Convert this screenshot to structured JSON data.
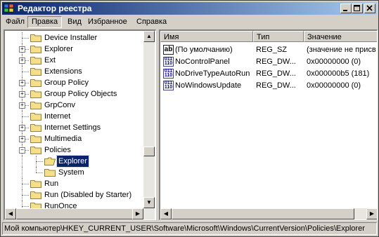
{
  "window": {
    "title": "Редактор реестра"
  },
  "menu": [
    "Файл",
    "Правка",
    "Вид",
    "Избранное",
    "Справка"
  ],
  "tree": [
    {
      "label": "Device Installer",
      "expander": ""
    },
    {
      "label": "Explorer",
      "expander": "+"
    },
    {
      "label": "Ext",
      "expander": "+"
    },
    {
      "label": "Extensions",
      "expander": ""
    },
    {
      "label": "Group Policy",
      "expander": "+"
    },
    {
      "label": "Group Policy Objects",
      "expander": "+"
    },
    {
      "label": "GrpConv",
      "expander": "+"
    },
    {
      "label": "Internet",
      "expander": ""
    },
    {
      "label": "Internet Settings",
      "expander": "+"
    },
    {
      "label": "Multimedia",
      "expander": "+"
    },
    {
      "label": "Policies",
      "expander": "−"
    },
    {
      "label": "Explorer",
      "expander": "",
      "child": true,
      "selected": true
    },
    {
      "label": "System",
      "expander": "",
      "child": true
    },
    {
      "label": "Run",
      "expander": ""
    },
    {
      "label": "Run (Disabled by Starter)",
      "expander": ""
    },
    {
      "label": "RunOnce",
      "expander": ""
    }
  ],
  "columns": {
    "name": "Имя",
    "type": "Тип",
    "value": "Значение"
  },
  "values": [
    {
      "name": "(По умолчанию)",
      "type": "REG_SZ",
      "data": "(значение не присв",
      "icon": "ab"
    },
    {
      "name": "NoControlPanel",
      "type": "REG_DW...",
      "data": "0x00000000 (0)",
      "icon": "bin"
    },
    {
      "name": "NoDriveTypeAutoRun",
      "type": "REG_DW...",
      "data": "0x000000b5 (181)",
      "icon": "bin"
    },
    {
      "name": "NoWindowsUpdate",
      "type": "REG_DW...",
      "data": "0x00000000 (0)",
      "icon": "bin"
    }
  ],
  "status": {
    "path": "Мой компьютер\\HKEY_CURRENT_USER\\Software\\Microsoft\\Windows\\CurrentVersion\\Policies\\Explorer"
  },
  "icons": {
    "ab": "ab",
    "bin": "011\n110"
  },
  "colors": {
    "title_start": "#0a246a",
    "title_end": "#a6caf0",
    "selection": "#0a246a",
    "folder": "#f4e08a"
  }
}
